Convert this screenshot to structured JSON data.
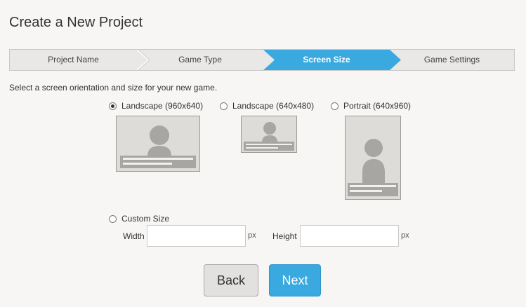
{
  "page_title": "Create a New Project",
  "steps": [
    {
      "label": "Project Name",
      "active": false
    },
    {
      "label": "Game Type",
      "active": false
    },
    {
      "label": "Screen Size",
      "active": true
    },
    {
      "label": "Game Settings",
      "active": false
    }
  ],
  "instruction": "Select a screen orientation and size for your new game.",
  "options": [
    {
      "label": "Landscape (960x640)",
      "checked": true
    },
    {
      "label": "Landscape (640x480)",
      "checked": false
    },
    {
      "label": "Portrait (640x960)",
      "checked": false
    }
  ],
  "custom": {
    "label": "Custom Size",
    "checked": false,
    "width_label": "Width",
    "width_value": "",
    "height_label": "Height",
    "height_value": "",
    "unit": "px"
  },
  "buttons": {
    "back": "Back",
    "next": "Next"
  },
  "colors": {
    "accent": "#3aa9df",
    "step_bg": "#e9e8e6",
    "preview_bg": "#dedcd8",
    "preview_fg": "#a8a6a2"
  },
  "icons": {
    "radio": "radio-button",
    "preview": "person-silhouette"
  }
}
